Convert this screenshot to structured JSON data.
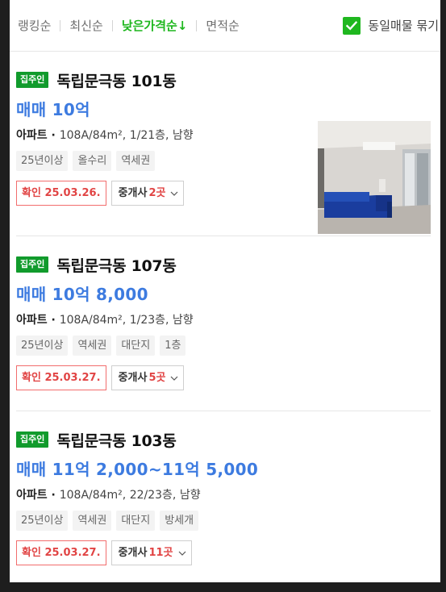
{
  "sort": {
    "options": [
      {
        "label": "랭킹순"
      },
      {
        "label": "최신순"
      },
      {
        "label": "낮은가격순↓"
      },
      {
        "label": "면적순"
      }
    ],
    "active_index": 2,
    "group_label": "동일매물 묶기",
    "group_checked": true
  },
  "listings": [
    {
      "badge": "집주인",
      "name": "독립문극동 101동",
      "price": "매매 10억",
      "type": "아파트",
      "detail": "108A/84m², 1/21층, 남향",
      "tags": [
        "25년이상",
        "올수리",
        "역세권"
      ],
      "confirmed": "확인 25.03.26.",
      "agents_label": "중개사",
      "agents_count": "2곳",
      "has_photo": true
    },
    {
      "badge": "집주인",
      "name": "독립문극동 107동",
      "price": "매매 10억 8,000",
      "type": "아파트",
      "detail": "108A/84m², 1/23층, 남향",
      "tags": [
        "25년이상",
        "역세권",
        "대단지",
        "1층"
      ],
      "confirmed": "확인 25.03.27.",
      "agents_label": "중개사",
      "agents_count": "5곳",
      "has_photo": false
    },
    {
      "badge": "집주인",
      "name": "독립문극동 103동",
      "price": "매매 11억 2,000~11억 5,000",
      "type": "아파트",
      "detail": "108A/84m², 22/23층, 남향",
      "tags": [
        "25년이상",
        "역세권",
        "대단지",
        "방세개"
      ],
      "confirmed": "확인 25.03.27.",
      "agents_label": "중개사",
      "agents_count": "11곳",
      "has_photo": false
    }
  ],
  "colors": {
    "accent_green": "#1fb71f",
    "badge_green": "#119b2c",
    "price_blue": "#3d7be0",
    "confirm_red": "#e14444"
  }
}
